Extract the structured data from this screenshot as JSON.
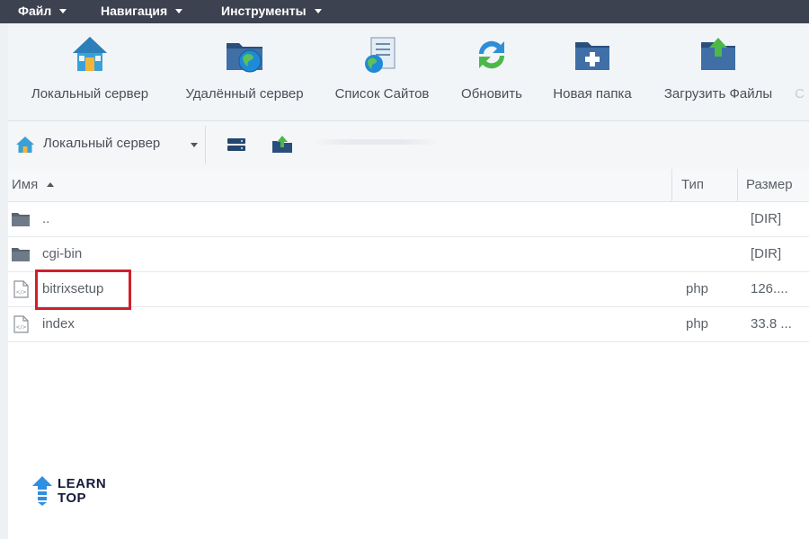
{
  "menu": {
    "items": [
      {
        "label": "Файл"
      },
      {
        "label": "Навигация"
      },
      {
        "label": "Инструменты"
      }
    ]
  },
  "toolbar": {
    "tools": [
      {
        "label": "Локальный сервер",
        "icon": "home-icon"
      },
      {
        "label": "Удалённый сервер",
        "icon": "remote-folder-globe-icon"
      },
      {
        "label": "Список Сайтов",
        "icon": "site-list-icon"
      },
      {
        "label": "Обновить",
        "icon": "refresh-icon"
      },
      {
        "label": "Новая папка",
        "icon": "new-folder-icon"
      },
      {
        "label": "Загрузить Файлы",
        "icon": "upload-icon"
      },
      {
        "label": "С",
        "icon": "truncated-tool"
      }
    ]
  },
  "location": {
    "label": "Локальный сервер",
    "icon": "home-icon"
  },
  "table": {
    "columns": {
      "name": "Имя",
      "type": "Тип",
      "size": "Размер"
    },
    "rows": [
      {
        "name": "..",
        "type": "",
        "size": "[DIR]",
        "icon": "folder-icon"
      },
      {
        "name": "cgi-bin",
        "type": "",
        "size": "[DIR]",
        "icon": "folder-icon"
      },
      {
        "name": "bitrixsetup",
        "type": "php",
        "size": "126....",
        "icon": "php-file-icon"
      },
      {
        "name": "index",
        "type": "php",
        "size": "33.8 ...",
        "icon": "php-file-icon"
      }
    ]
  },
  "logo": {
    "line1": "LEARN",
    "line2": "TOP"
  },
  "colors": {
    "menubar": "#3d4250",
    "ribbon": "#f2f5f8",
    "highlight": "#d01f2b",
    "text": "#5b6068"
  }
}
